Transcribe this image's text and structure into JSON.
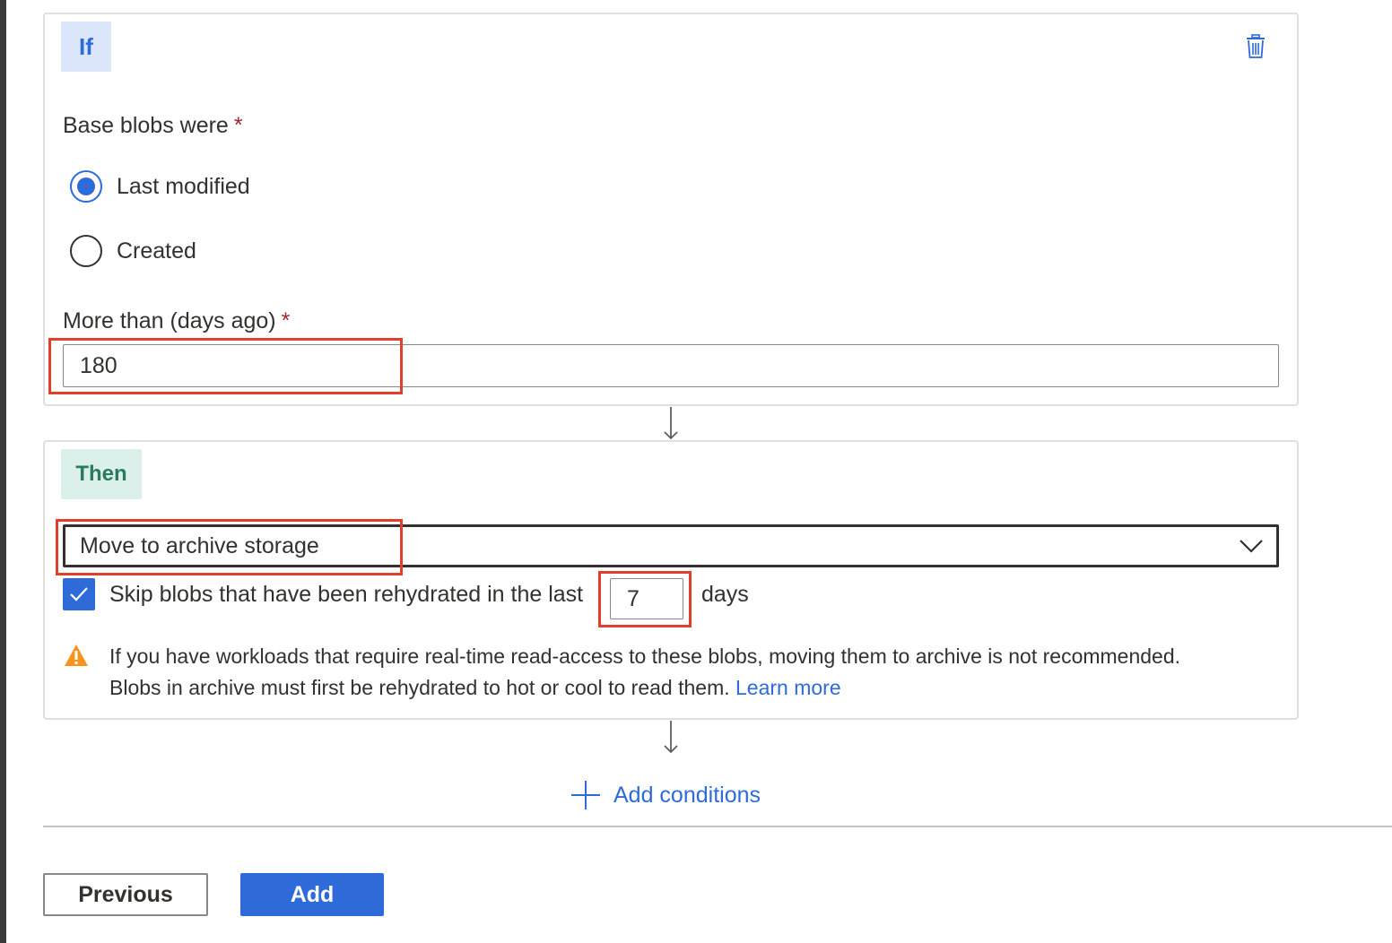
{
  "if_block": {
    "tag": "If",
    "base_blobs_label": "Base blobs were",
    "required_mark": "*",
    "options": [
      {
        "label": "Last modified",
        "selected": true
      },
      {
        "label": "Created",
        "selected": false
      }
    ],
    "days_label": "More than (days ago)",
    "days_value": "180"
  },
  "then_block": {
    "tag": "Then",
    "action_value": "Move to archive storage",
    "skip_checked": true,
    "skip_text": "Skip blobs that have been rehydrated in the last",
    "skip_days_value": "7",
    "days_text": "days",
    "warning_line1": "If you have workloads that require real-time read-access to these blobs, moving them to archive is not recommended.",
    "warning_line2": "Blobs in archive must first be rehydrated to hot or cool to read them.",
    "learn_more": "Learn more"
  },
  "add_conditions_label": "Add conditions",
  "buttons": {
    "previous": "Previous",
    "add": "Add"
  },
  "colors": {
    "accent": "#2e6bd9",
    "if_tag_bg": "#dce6fb",
    "then_tag_bg": "#dbf0ea",
    "highlight": "#e0402b",
    "warning": "#f7941d"
  },
  "icons": {
    "delete": "trash-icon",
    "arrow": "arrow-down-icon",
    "dropdown": "chevron-down-icon",
    "check": "checkmark-icon",
    "warning": "warning-icon",
    "add": "plus-icon"
  }
}
